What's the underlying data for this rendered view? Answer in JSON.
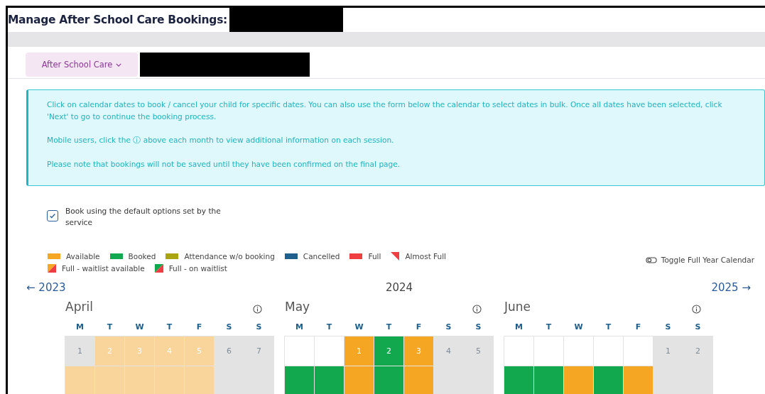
{
  "page_title": "Manage After School Care Bookings:",
  "service_dropdown": {
    "label": "After School Care"
  },
  "info_box": {
    "paragraphs": [
      "Click on calendar dates to book / cancel your child for specific dates. You can also use the form below the calendar to select dates in bulk. Once all dates have been selected, click 'Next' to go to continue the booking process.",
      "Mobile users, click the ⓘ above each month to view additional information on each session.",
      "Please note that bookings will not be saved until they have been confirmed on the final page."
    ]
  },
  "default_options": {
    "label": "Book using the default options set by the service",
    "checked": true
  },
  "legend": [
    {
      "label": "Available",
      "kind": "solid",
      "color": "#f5a623"
    },
    {
      "label": "Booked",
      "kind": "solid",
      "color": "#12a84e"
    },
    {
      "label": "Attendance w/o booking",
      "kind": "solid",
      "color": "#a9a410"
    },
    {
      "label": "Cancelled",
      "kind": "solid",
      "color": "#1e5f8c"
    },
    {
      "label": "Full",
      "kind": "solid",
      "color": "#ef3e42"
    },
    {
      "label": "Almost Full",
      "kind": "corner",
      "color": "#ef3e42"
    },
    {
      "label": "Full - waitlist available",
      "kind": "split",
      "color": "#f5a623"
    },
    {
      "label": "Full - on waitlist",
      "kind": "split",
      "color": "#12a84e"
    }
  ],
  "toggle": {
    "label": "Toggle Full Year Calendar"
  },
  "year_nav": {
    "previous": "← 2023",
    "current": "2024",
    "next": "2025 →"
  },
  "months": [
    {
      "name": "April",
      "weekdays": [
        "M",
        "T",
        "W",
        "T",
        "F",
        "S",
        "S"
      ],
      "weeks": [
        [
          {
            "day": "1",
            "kind": "closed"
          },
          {
            "day": "2",
            "kind": "past"
          },
          {
            "day": "3",
            "kind": "past"
          },
          {
            "day": "4",
            "kind": "past"
          },
          {
            "day": "5",
            "kind": "past"
          },
          {
            "day": "6",
            "kind": "closed"
          },
          {
            "day": "7",
            "kind": "closed"
          }
        ],
        [
          {
            "kind": "past"
          },
          {
            "kind": "past"
          },
          {
            "kind": "past"
          },
          {
            "kind": "past"
          },
          {
            "kind": "past"
          },
          {
            "kind": "closed"
          },
          {
            "kind": "closed"
          }
        ]
      ]
    },
    {
      "name": "May",
      "weekdays": [
        "M",
        "T",
        "W",
        "T",
        "F",
        "S",
        "S"
      ],
      "weeks": [
        [
          {
            "kind": "empty"
          },
          {
            "kind": "empty"
          },
          {
            "day": "1",
            "kind": "available"
          },
          {
            "day": "2",
            "kind": "booked"
          },
          {
            "day": "3",
            "kind": "available"
          },
          {
            "day": "4",
            "kind": "closed"
          },
          {
            "day": "5",
            "kind": "closed"
          }
        ],
        [
          {
            "kind": "booked"
          },
          {
            "kind": "booked"
          },
          {
            "kind": "available"
          },
          {
            "kind": "booked"
          },
          {
            "kind": "available"
          },
          {
            "kind": "closed"
          },
          {
            "kind": "closed"
          }
        ]
      ]
    },
    {
      "name": "June",
      "weekdays": [
        "M",
        "T",
        "W",
        "T",
        "F",
        "S",
        "S"
      ],
      "weeks": [
        [
          {
            "kind": "empty"
          },
          {
            "kind": "empty"
          },
          {
            "kind": "empty"
          },
          {
            "kind": "empty"
          },
          {
            "kind": "empty"
          },
          {
            "day": "1",
            "kind": "closed"
          },
          {
            "day": "2",
            "kind": "closed"
          }
        ],
        [
          {
            "kind": "booked"
          },
          {
            "kind": "booked"
          },
          {
            "kind": "available"
          },
          {
            "kind": "booked"
          },
          {
            "kind": "available"
          },
          {
            "kind": "closed"
          },
          {
            "kind": "closed"
          }
        ]
      ]
    }
  ]
}
